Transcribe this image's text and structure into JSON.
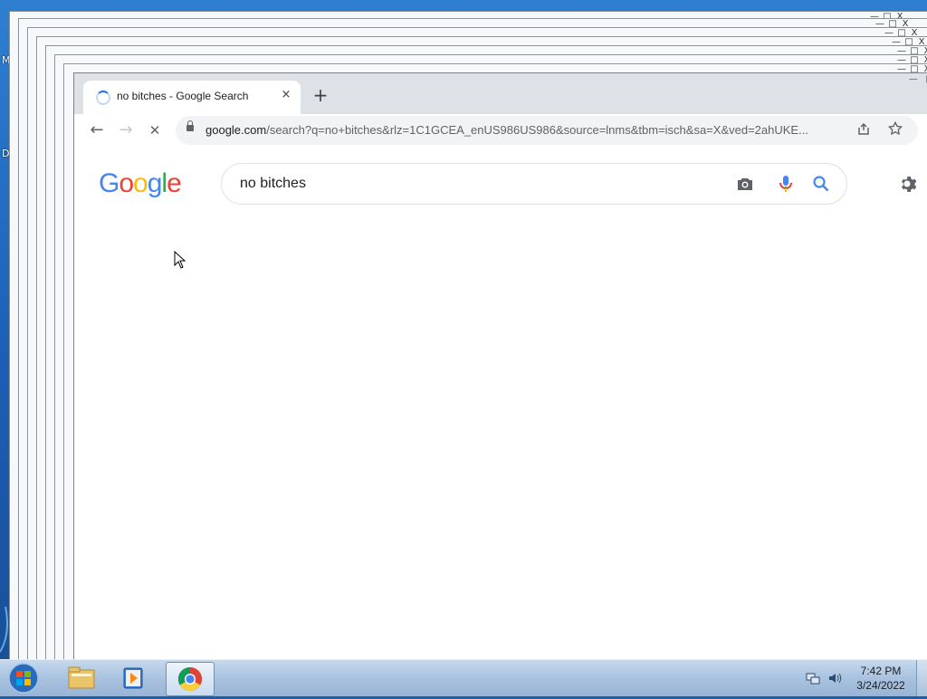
{
  "desktop": {
    "edge_letters": [
      "M",
      "D"
    ]
  },
  "stack_window_controls": {
    "minimize": "—",
    "maximize": "□",
    "close": "X"
  },
  "browser": {
    "tab_title": "no bitches - Google Search",
    "tab_close": "×",
    "new_tab": "+",
    "url_host": "google.com",
    "url_path": "/search?q=no+bitches&rlz=1C1GCEA_enUS986US986&source=lnms&tbm=isch&sa=X&ved=2ahUKE...",
    "nav_back": "←",
    "nav_forward": "→",
    "nav_stop": "✕"
  },
  "google": {
    "logo_letters": [
      {
        "ch": "G",
        "color": "#4285F4"
      },
      {
        "ch": "o",
        "color": "#EA4335"
      },
      {
        "ch": "o",
        "color": "#FBBC05"
      },
      {
        "ch": "g",
        "color": "#4285F4"
      },
      {
        "ch": "l",
        "color": "#34A853"
      },
      {
        "ch": "e",
        "color": "#EA4335"
      }
    ],
    "query": "no bitches"
  },
  "taskbar": {
    "clock_time": "7:42 PM",
    "clock_date": "3/24/2022"
  },
  "colors": {
    "accent_blue": "#1a73e8",
    "taskbar": "#a9c2df"
  },
  "icons": [
    "windows-start-icon",
    "file-explorer-icon",
    "media-player-icon",
    "chrome-icon",
    "network-icon",
    "volume-icon",
    "camera-icon",
    "microphone-icon",
    "search-icon",
    "settings-gear-icon",
    "lock-icon",
    "share-icon",
    "star-icon"
  ]
}
